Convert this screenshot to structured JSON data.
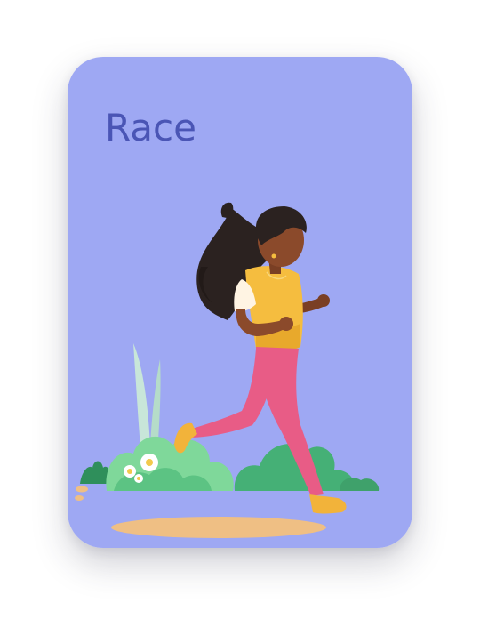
{
  "card": {
    "title": "Race",
    "illustration": "woman-running-illustration"
  },
  "colors": {
    "card_background": "#9ea8f3",
    "title_text": "#4a55b5",
    "skin": "#8b4a2b",
    "hair": "#2b2220",
    "vest": "#f5bd3f",
    "leggings": "#e85c86",
    "shoes": "#f2b33a",
    "bush_light": "#7fd89a",
    "bush_dark": "#45b076",
    "ground": "#efbf84"
  }
}
